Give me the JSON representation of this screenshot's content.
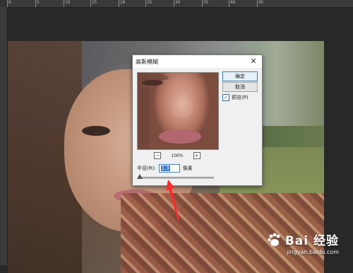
{
  "ruler": {
    "ticks": [
      "0",
      "5",
      "10",
      "15",
      "20",
      "25",
      "30",
      "35",
      "40",
      "45"
    ]
  },
  "dialog": {
    "title": "高斯模糊",
    "close": "✕",
    "ok_label": "确定",
    "cancel_label": "取消",
    "preview_label": "预览(P)",
    "preview_checked": true,
    "zoom_out": "−",
    "zoom_level": "100%",
    "zoom_in": "+",
    "radius_label": "半径(R):",
    "radius_value": "1.3",
    "radius_unit": "像素",
    "radius_slider_fraction": 0.01
  },
  "annotation": {
    "arrow_color": "#ff2a2a"
  },
  "watermark": {
    "brand": "Bai 经验",
    "url": "jingyan.baidu.com"
  }
}
